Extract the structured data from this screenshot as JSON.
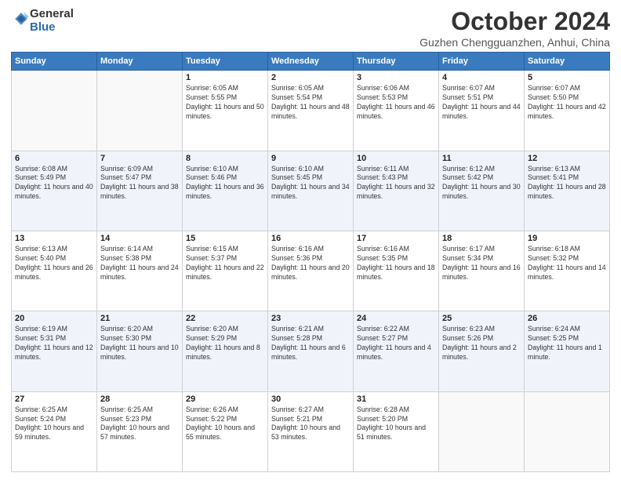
{
  "header": {
    "logo_general": "General",
    "logo_blue": "Blue",
    "month_title": "October 2024",
    "location": "Guzhen Chengguanzhen, Anhui, China"
  },
  "days_of_week": [
    "Sunday",
    "Monday",
    "Tuesday",
    "Wednesday",
    "Thursday",
    "Friday",
    "Saturday"
  ],
  "weeks": [
    [
      {
        "day": "",
        "info": ""
      },
      {
        "day": "",
        "info": ""
      },
      {
        "day": "1",
        "info": "Sunrise: 6:05 AM\nSunset: 5:55 PM\nDaylight: 11 hours and 50 minutes."
      },
      {
        "day": "2",
        "info": "Sunrise: 6:05 AM\nSunset: 5:54 PM\nDaylight: 11 hours and 48 minutes."
      },
      {
        "day": "3",
        "info": "Sunrise: 6:06 AM\nSunset: 5:53 PM\nDaylight: 11 hours and 46 minutes."
      },
      {
        "day": "4",
        "info": "Sunrise: 6:07 AM\nSunset: 5:51 PM\nDaylight: 11 hours and 44 minutes."
      },
      {
        "day": "5",
        "info": "Sunrise: 6:07 AM\nSunset: 5:50 PM\nDaylight: 11 hours and 42 minutes."
      }
    ],
    [
      {
        "day": "6",
        "info": "Sunrise: 6:08 AM\nSunset: 5:49 PM\nDaylight: 11 hours and 40 minutes."
      },
      {
        "day": "7",
        "info": "Sunrise: 6:09 AM\nSunset: 5:47 PM\nDaylight: 11 hours and 38 minutes."
      },
      {
        "day": "8",
        "info": "Sunrise: 6:10 AM\nSunset: 5:46 PM\nDaylight: 11 hours and 36 minutes."
      },
      {
        "day": "9",
        "info": "Sunrise: 6:10 AM\nSunset: 5:45 PM\nDaylight: 11 hours and 34 minutes."
      },
      {
        "day": "10",
        "info": "Sunrise: 6:11 AM\nSunset: 5:43 PM\nDaylight: 11 hours and 32 minutes."
      },
      {
        "day": "11",
        "info": "Sunrise: 6:12 AM\nSunset: 5:42 PM\nDaylight: 11 hours and 30 minutes."
      },
      {
        "day": "12",
        "info": "Sunrise: 6:13 AM\nSunset: 5:41 PM\nDaylight: 11 hours and 28 minutes."
      }
    ],
    [
      {
        "day": "13",
        "info": "Sunrise: 6:13 AM\nSunset: 5:40 PM\nDaylight: 11 hours and 26 minutes."
      },
      {
        "day": "14",
        "info": "Sunrise: 6:14 AM\nSunset: 5:38 PM\nDaylight: 11 hours and 24 minutes."
      },
      {
        "day": "15",
        "info": "Sunrise: 6:15 AM\nSunset: 5:37 PM\nDaylight: 11 hours and 22 minutes."
      },
      {
        "day": "16",
        "info": "Sunrise: 6:16 AM\nSunset: 5:36 PM\nDaylight: 11 hours and 20 minutes."
      },
      {
        "day": "17",
        "info": "Sunrise: 6:16 AM\nSunset: 5:35 PM\nDaylight: 11 hours and 18 minutes."
      },
      {
        "day": "18",
        "info": "Sunrise: 6:17 AM\nSunset: 5:34 PM\nDaylight: 11 hours and 16 minutes."
      },
      {
        "day": "19",
        "info": "Sunrise: 6:18 AM\nSunset: 5:32 PM\nDaylight: 11 hours and 14 minutes."
      }
    ],
    [
      {
        "day": "20",
        "info": "Sunrise: 6:19 AM\nSunset: 5:31 PM\nDaylight: 11 hours and 12 minutes."
      },
      {
        "day": "21",
        "info": "Sunrise: 6:20 AM\nSunset: 5:30 PM\nDaylight: 11 hours and 10 minutes."
      },
      {
        "day": "22",
        "info": "Sunrise: 6:20 AM\nSunset: 5:29 PM\nDaylight: 11 hours and 8 minutes."
      },
      {
        "day": "23",
        "info": "Sunrise: 6:21 AM\nSunset: 5:28 PM\nDaylight: 11 hours and 6 minutes."
      },
      {
        "day": "24",
        "info": "Sunrise: 6:22 AM\nSunset: 5:27 PM\nDaylight: 11 hours and 4 minutes."
      },
      {
        "day": "25",
        "info": "Sunrise: 6:23 AM\nSunset: 5:26 PM\nDaylight: 11 hours and 2 minutes."
      },
      {
        "day": "26",
        "info": "Sunrise: 6:24 AM\nSunset: 5:25 PM\nDaylight: 11 hours and 1 minute."
      }
    ],
    [
      {
        "day": "27",
        "info": "Sunrise: 6:25 AM\nSunset: 5:24 PM\nDaylight: 10 hours and 59 minutes."
      },
      {
        "day": "28",
        "info": "Sunrise: 6:25 AM\nSunset: 5:23 PM\nDaylight: 10 hours and 57 minutes."
      },
      {
        "day": "29",
        "info": "Sunrise: 6:26 AM\nSunset: 5:22 PM\nDaylight: 10 hours and 55 minutes."
      },
      {
        "day": "30",
        "info": "Sunrise: 6:27 AM\nSunset: 5:21 PM\nDaylight: 10 hours and 53 minutes."
      },
      {
        "day": "31",
        "info": "Sunrise: 6:28 AM\nSunset: 5:20 PM\nDaylight: 10 hours and 51 minutes."
      },
      {
        "day": "",
        "info": ""
      },
      {
        "day": "",
        "info": ""
      }
    ]
  ]
}
